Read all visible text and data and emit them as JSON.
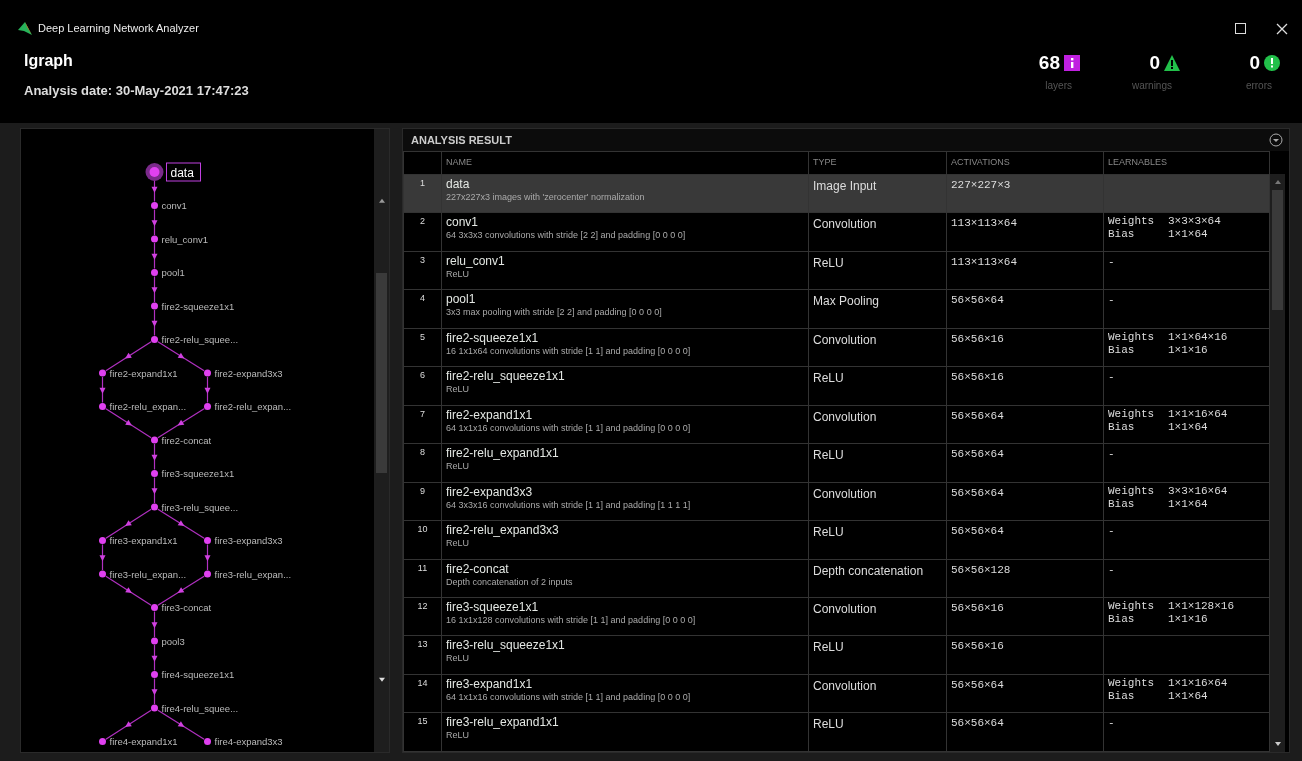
{
  "window": {
    "title": "Deep Learning Network Analyzer"
  },
  "header": {
    "network": "lgraph",
    "analysis_date": "Analysis date: 30-May-2021 17:47:23",
    "stats": [
      {
        "kind": "info",
        "count": "68",
        "label": "layers"
      },
      {
        "kind": "warning",
        "count": "0",
        "label": "warnings"
      },
      {
        "kind": "error",
        "count": "0",
        "label": "errors"
      }
    ]
  },
  "graph": {
    "items": [
      {
        "kind": "node",
        "label": "data",
        "selected": true
      },
      {
        "kind": "node",
        "label": "conv1",
        "selected": false
      },
      {
        "kind": "node",
        "label": "relu_conv1",
        "selected": false
      },
      {
        "kind": "node",
        "label": "pool1",
        "selected": false
      },
      {
        "kind": "node",
        "label": "fire2-squeeze1x1",
        "selected": false
      },
      {
        "kind": "node",
        "label": "fire2-relu_squee...",
        "selected": false
      },
      {
        "kind": "branch",
        "left": [
          {
            "label": "fire2-expand1x1",
            "selected": false
          },
          {
            "label": "fire2-relu_expan...",
            "selected": false
          }
        ],
        "right": [
          {
            "label": "fire2-expand3x3",
            "selected": false
          },
          {
            "label": "fire2-relu_expan...",
            "selected": false
          }
        ]
      },
      {
        "kind": "node",
        "label": "fire2-concat",
        "selected": false
      },
      {
        "kind": "node",
        "label": "fire3-squeeze1x1",
        "selected": false
      },
      {
        "kind": "node",
        "label": "fire3-relu_squee...",
        "selected": false
      },
      {
        "kind": "branch",
        "left": [
          {
            "label": "fire3-expand1x1",
            "selected": false
          },
          {
            "label": "fire3-relu_expan...",
            "selected": false
          }
        ],
        "right": [
          {
            "label": "fire3-expand3x3",
            "selected": false
          },
          {
            "label": "fire3-relu_expan...",
            "selected": false
          }
        ]
      },
      {
        "kind": "node",
        "label": "fire3-concat",
        "selected": false
      },
      {
        "kind": "node",
        "label": "pool3",
        "selected": false
      },
      {
        "kind": "node",
        "label": "fire4-squeeze1x1",
        "selected": false
      },
      {
        "kind": "node",
        "label": "fire4-relu_squee...",
        "selected": false
      },
      {
        "kind": "branch",
        "left": [
          {
            "label": "fire4-expand1x1",
            "selected": false
          }
        ],
        "right": [
          {
            "label": "fire4-expand3x3",
            "selected": false
          }
        ]
      }
    ]
  },
  "table": {
    "title": "ANALYSIS RESULT",
    "columns": [
      "NAME",
      "TYPE",
      "ACTIVATIONS",
      "LEARNABLES"
    ],
    "rows": [
      {
        "index": "1",
        "name": "data",
        "description": "227x227x3 images with 'zerocenter' normalization",
        "type": "Image Input",
        "activations": "227×227×3",
        "selected": true
      },
      {
        "index": "2",
        "name": "conv1",
        "description": "64 3x3x3 convolutions with stride [2 2] and padding [0 0 0 0]",
        "type": "Convolution",
        "activations": "113×113×64",
        "learnables": [
          {
            "name": "Weights",
            "size": "3×3×3×64"
          },
          {
            "name": "Bias",
            "size": "1×1×64"
          }
        ],
        "selected": false
      },
      {
        "index": "3",
        "name": "relu_conv1",
        "description": "ReLU",
        "type": "ReLU",
        "activations": "113×113×64",
        "learnables": "-",
        "selected": false
      },
      {
        "index": "4",
        "name": "pool1",
        "description": "3x3 max pooling with stride [2 2] and padding [0 0 0 0]",
        "type": "Max Pooling",
        "activations": "56×56×64",
        "learnables": "-",
        "selected": false
      },
      {
        "index": "5",
        "name": "fire2-squeeze1x1",
        "description": "16 1x1x64 convolutions with stride [1 1] and padding [0 0 0 0]",
        "type": "Convolution",
        "activations": "56×56×16",
        "learnables": [
          {
            "name": "Weights",
            "size": "1×1×64×16"
          },
          {
            "name": "Bias",
            "size": "1×1×16"
          }
        ],
        "selected": false
      },
      {
        "index": "6",
        "name": "fire2-relu_squeeze1x1",
        "description": "ReLU",
        "type": "ReLU",
        "activations": "56×56×16",
        "learnables": "-",
        "selected": false
      },
      {
        "index": "7",
        "name": "fire2-expand1x1",
        "description": "64 1x1x16 convolutions with stride [1 1] and padding [0 0 0 0]",
        "type": "Convolution",
        "activations": "56×56×64",
        "learnables": [
          {
            "name": "Weights",
            "size": "1×1×16×64"
          },
          {
            "name": "Bias",
            "size": "1×1×64"
          }
        ],
        "selected": false
      },
      {
        "index": "8",
        "name": "fire2-relu_expand1x1",
        "description": "ReLU",
        "type": "ReLU",
        "activations": "56×56×64",
        "learnables": "-",
        "selected": false
      },
      {
        "index": "9",
        "name": "fire2-expand3x3",
        "description": "64 3x3x16 convolutions with stride [1 1] and padding [1 1 1 1]",
        "type": "Convolution",
        "activations": "56×56×64",
        "learnables": [
          {
            "name": "Weights",
            "size": "3×3×16×64"
          },
          {
            "name": "Bias",
            "size": "1×1×64"
          }
        ],
        "selected": false
      },
      {
        "index": "10",
        "name": "fire2-relu_expand3x3",
        "description": "ReLU",
        "type": "ReLU",
        "activations": "56×56×64",
        "learnables": "-",
        "selected": false
      },
      {
        "index": "11",
        "name": "fire2-concat",
        "description": "Depth concatenation of 2 inputs",
        "type": "Depth concatenation",
        "activations": "56×56×128",
        "learnables": "-",
        "selected": false
      },
      {
        "index": "12",
        "name": "fire3-squeeze1x1",
        "description": "16 1x1x128 convolutions with stride [1 1] and padding [0 0 0 0]",
        "type": "Convolution",
        "activations": "56×56×16",
        "learnables": [
          {
            "name": "Weights",
            "size": "1×1×128×16"
          },
          {
            "name": "Bias",
            "size": "1×1×16"
          }
        ],
        "selected": false
      },
      {
        "index": "13",
        "name": "fire3-relu_squeeze1x1",
        "description": "ReLU",
        "type": "ReLU",
        "activations": "56×56×16",
        "selected": false
      },
      {
        "index": "14",
        "name": "fire3-expand1x1",
        "description": "64 1x1x16 convolutions with stride [1 1] and padding [0 0 0 0]",
        "type": "Convolution",
        "activations": "56×56×64",
        "learnables": [
          {
            "name": "Weights",
            "size": "1×1×16×64"
          },
          {
            "name": "Bias",
            "size": "1×1×64"
          }
        ],
        "selected": false
      },
      {
        "index": "15",
        "name": "fire3-relu_expand1x1",
        "description": "ReLU",
        "type": "ReLU",
        "activations": "56×56×64",
        "learnables": "-",
        "selected": false
      }
    ]
  }
}
